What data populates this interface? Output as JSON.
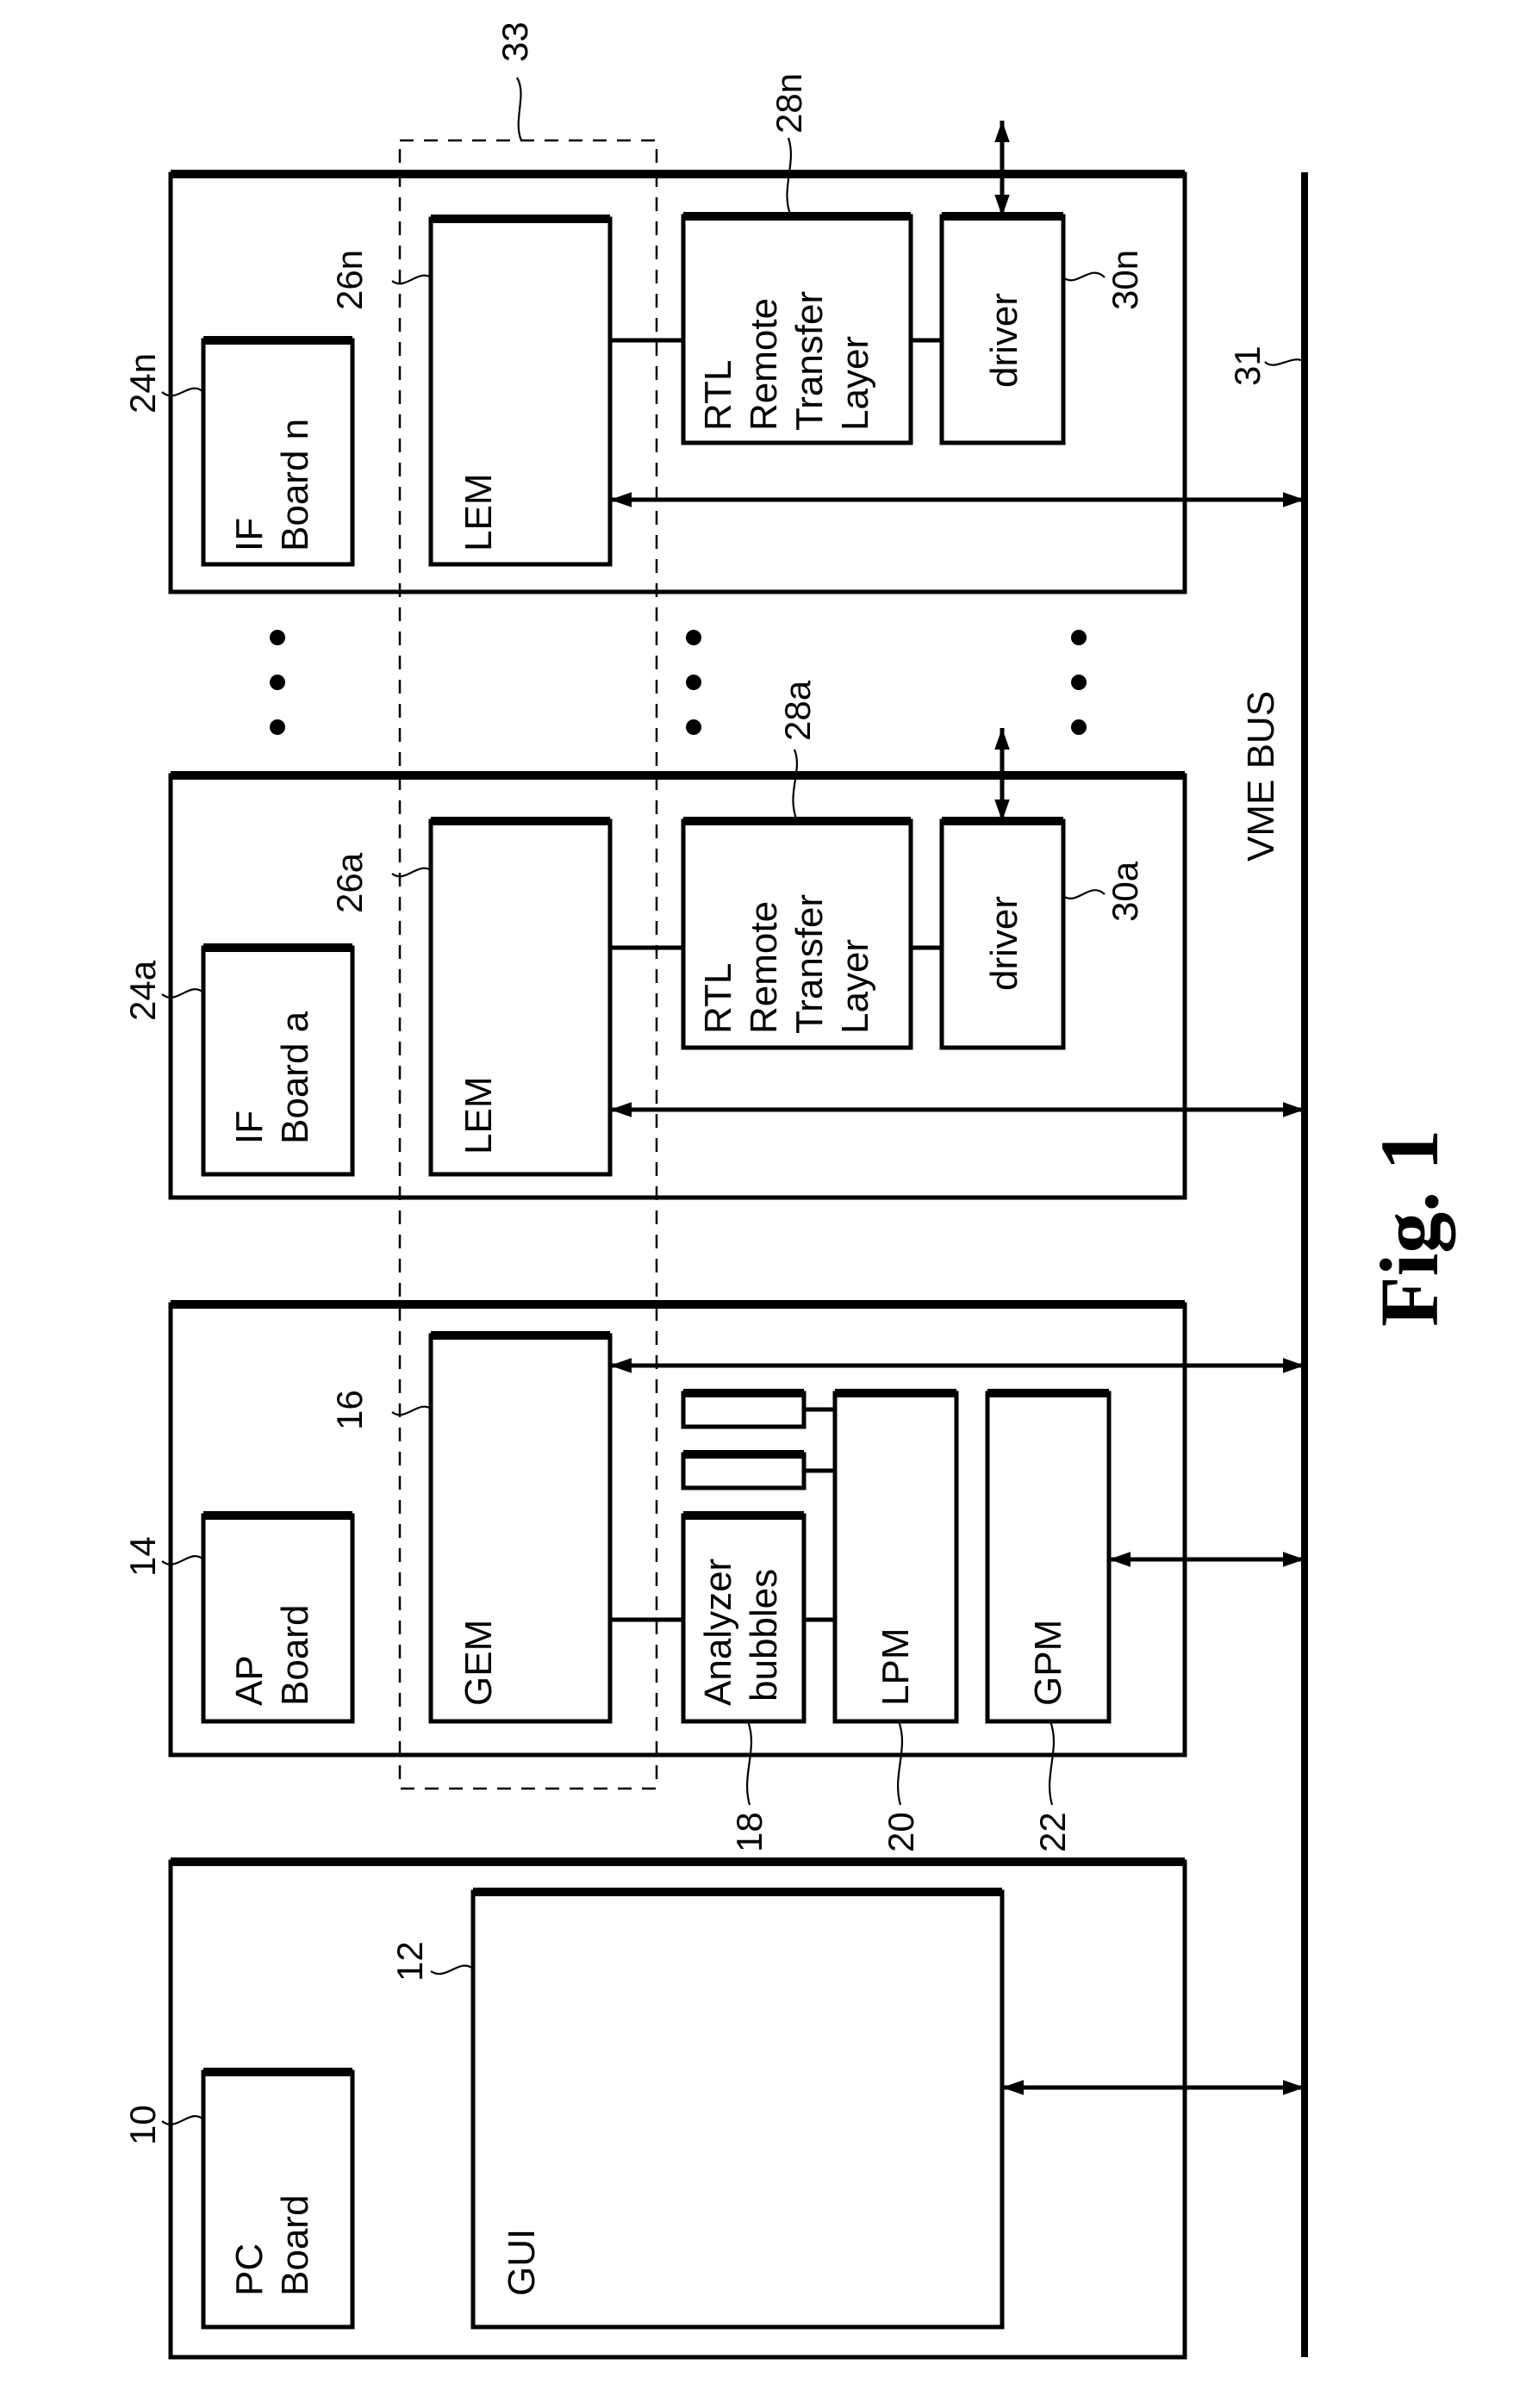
{
  "figure": {
    "caption": "Fig. 1"
  },
  "bus": {
    "label": "VME BUS",
    "ref": "31"
  },
  "group": {
    "ref": "33"
  },
  "boards": {
    "pc": {
      "board_label": [
        "PC",
        "Board"
      ],
      "board_ref": "10",
      "gui_label": "GUI",
      "gui_ref": "12"
    },
    "ap": {
      "board_label": [
        "AP",
        "Board"
      ],
      "board_ref": "14",
      "gem_label": "GEM",
      "gem_ref": "16",
      "analyzer_label": [
        "Analyzer",
        "bubbles"
      ],
      "analyzer_ref": "18",
      "lpm_label": "LPM",
      "lpm_ref": "20",
      "gpm_label": "GPM",
      "gpm_ref": "22"
    },
    "if_a": {
      "board_label": [
        "IF",
        "Board a"
      ],
      "board_ref": "24a",
      "lem_label": "LEM",
      "lem_ref": "26a",
      "rtl_label": [
        "RTL",
        "Remote",
        "Transfer",
        "Layer"
      ],
      "rtl_ref": "28a",
      "driver_label": "driver",
      "driver_ref": "30a"
    },
    "if_n": {
      "board_label": [
        "IF",
        "Board n"
      ],
      "board_ref": "24n",
      "lem_label": "LEM",
      "lem_ref": "26n",
      "rtl_label": [
        "RTL",
        "Remote",
        "Transfer",
        "Layer"
      ],
      "rtl_ref": "28n",
      "driver_label": "driver",
      "driver_ref": "30n"
    }
  },
  "ellipsis": "•••"
}
